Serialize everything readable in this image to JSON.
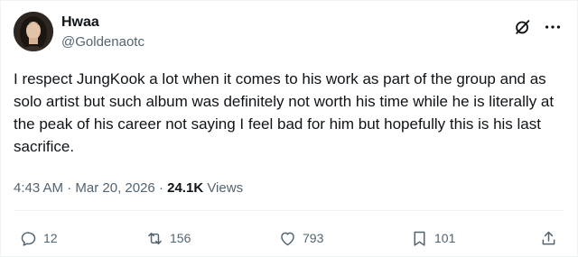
{
  "author": {
    "name": "Hwaa",
    "handle": "@Goldenaotc"
  },
  "tweet": {
    "text": "I respect JungKook a lot when it comes to his work as part of the group and as solo artist but such album was definitely not worth his time while he is literally at the peak of his career not saying I feel bad for him but hopefully this is his last sacrifice."
  },
  "meta": {
    "time": "4:43 AM",
    "separator": " · ",
    "date": "Mar 20, 2026",
    "views_count": "24.1K",
    "views_label": "Views"
  },
  "actions": {
    "replies": "12",
    "reposts": "156",
    "likes": "793",
    "bookmarks": "101"
  },
  "icons": {
    "header": [
      "grok-icon",
      "more-icon"
    ],
    "actions": [
      "reply-icon",
      "retweet-icon",
      "like-icon",
      "bookmark-icon",
      "share-icon"
    ]
  }
}
